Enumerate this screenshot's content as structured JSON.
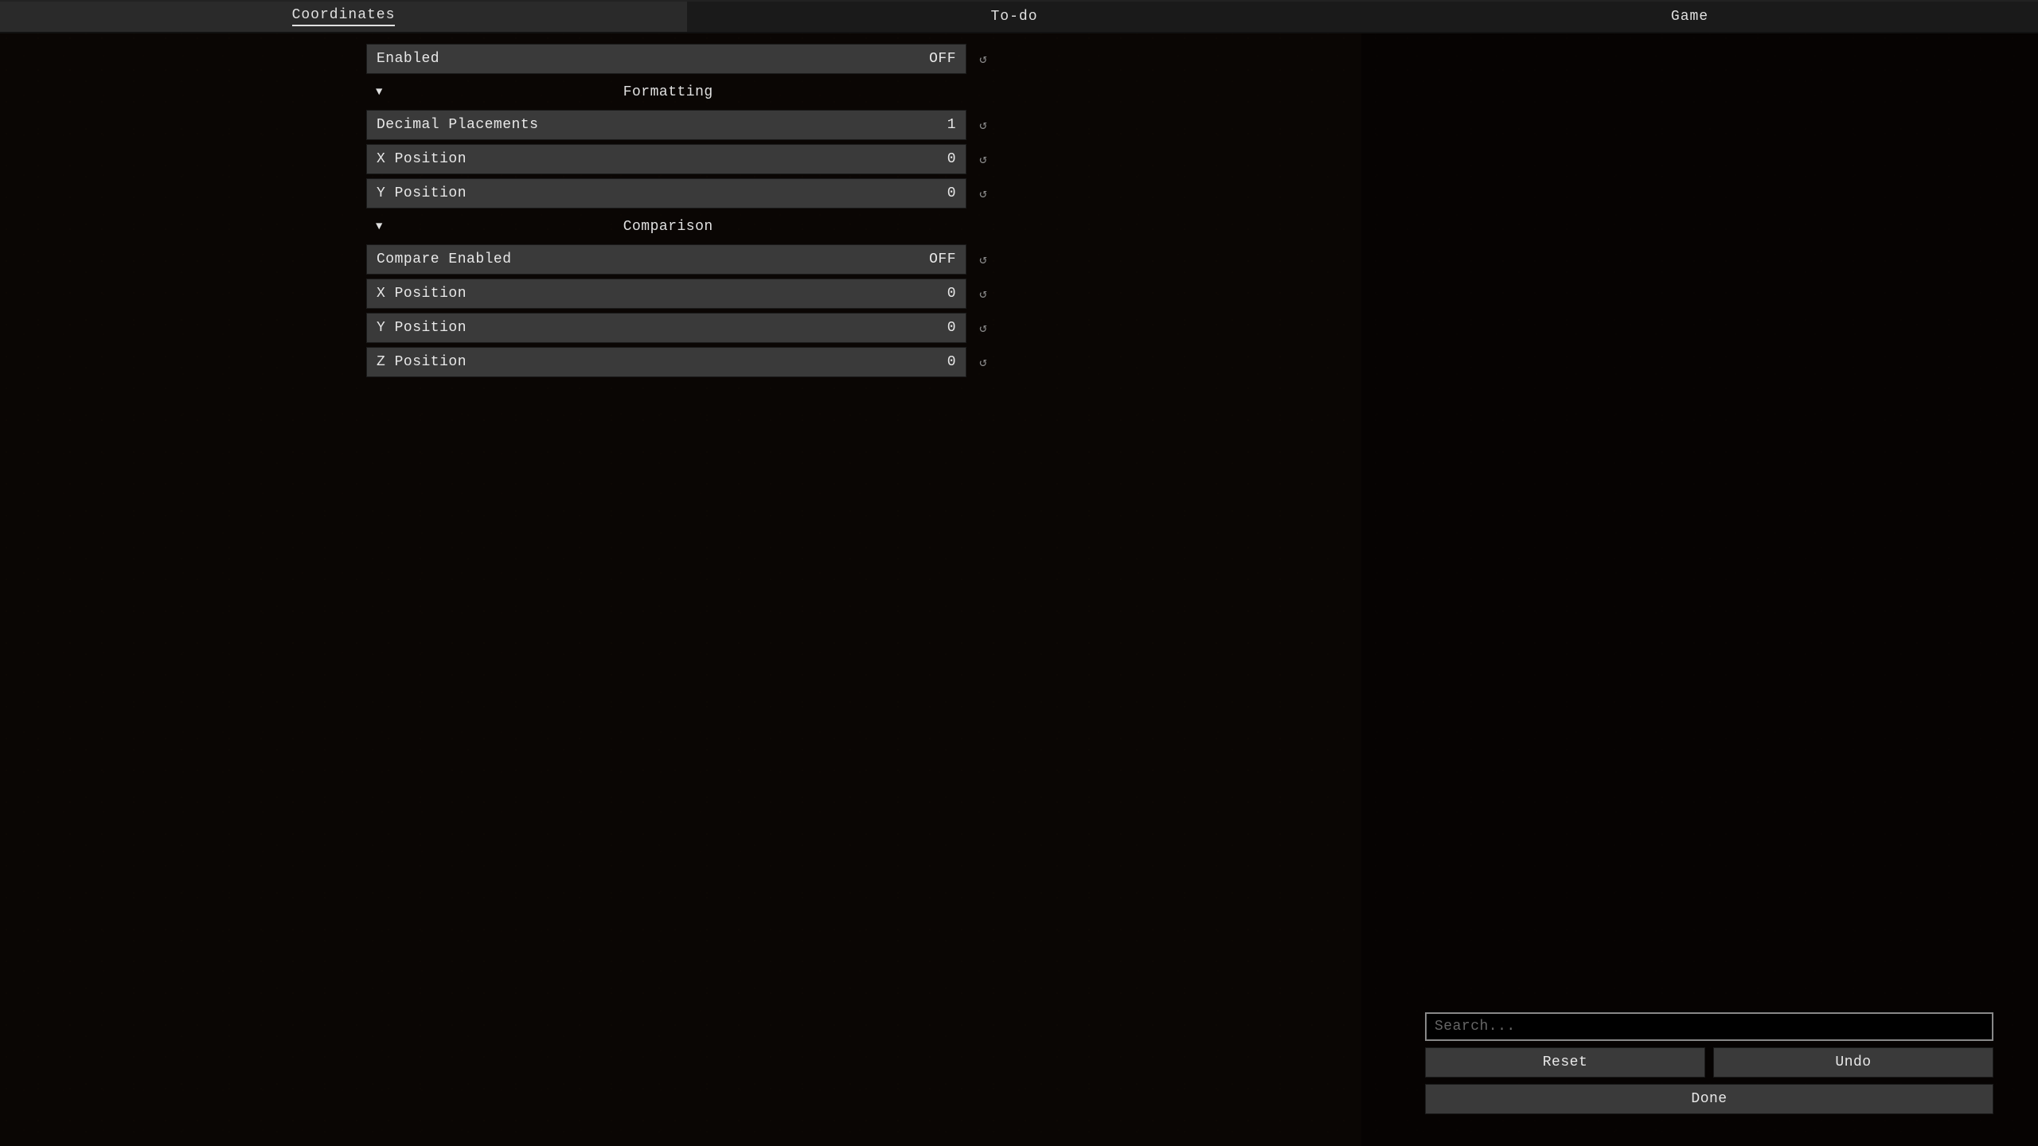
{
  "tabs": {
    "coordinates": "Coordinates",
    "todo": "To-do",
    "game": "Game"
  },
  "settings": {
    "enabled": {
      "label": "Enabled",
      "value": "OFF"
    },
    "formatting": {
      "title": "Formatting",
      "decimal_placements": {
        "label": "Decimal Placements",
        "value": "1"
      },
      "x_position": {
        "label": "X Position",
        "value": "0"
      },
      "y_position": {
        "label": "Y Position",
        "value": "0"
      }
    },
    "comparison": {
      "title": "Comparison",
      "compare_enabled": {
        "label": "Compare Enabled",
        "value": "OFF"
      },
      "x_position": {
        "label": "X Position",
        "value": "0"
      },
      "y_position": {
        "label": "Y Position",
        "value": "0"
      },
      "z_position": {
        "label": "Z Position",
        "value": "0"
      }
    }
  },
  "controls": {
    "search_placeholder": "Search...",
    "reset": "Reset",
    "undo": "Undo",
    "done": "Done"
  }
}
